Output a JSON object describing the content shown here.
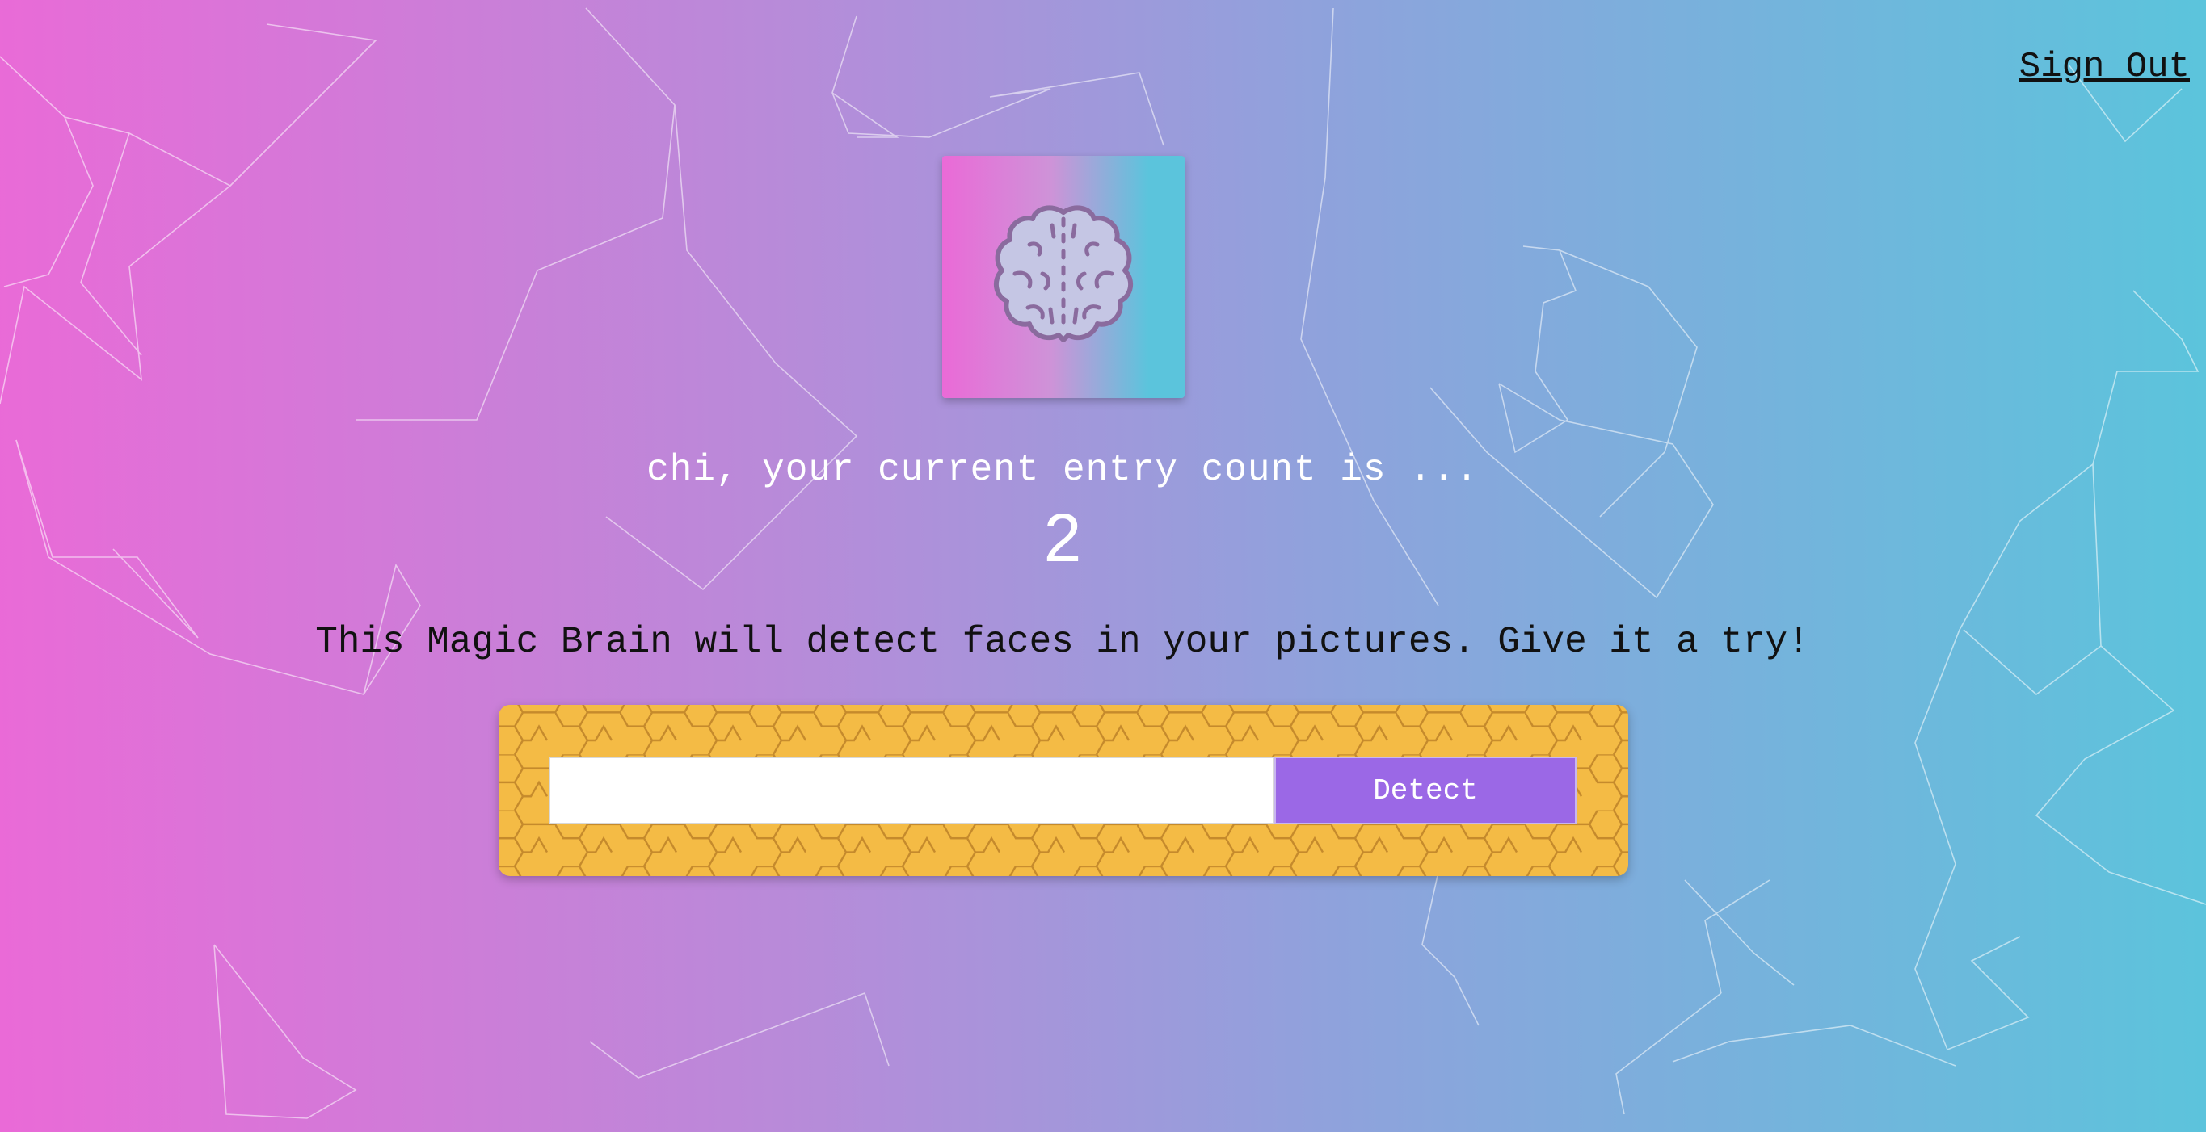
{
  "nav": {
    "signout_label": "Sign Out"
  },
  "logo": {
    "icon": "brain-icon"
  },
  "rank": {
    "message": "chi, your current entry count is ...",
    "count": "2"
  },
  "tagline": "This Magic Brain will detect faces in your pictures. Give it a try!",
  "form": {
    "input_value": "",
    "input_placeholder": "",
    "button_label": "Detect"
  },
  "colors": {
    "gradient_left": "#ea6ad7",
    "gradient_right": "#5bc4dc",
    "card_bg": "#f4bb45",
    "button_bg": "#9b68e6"
  }
}
